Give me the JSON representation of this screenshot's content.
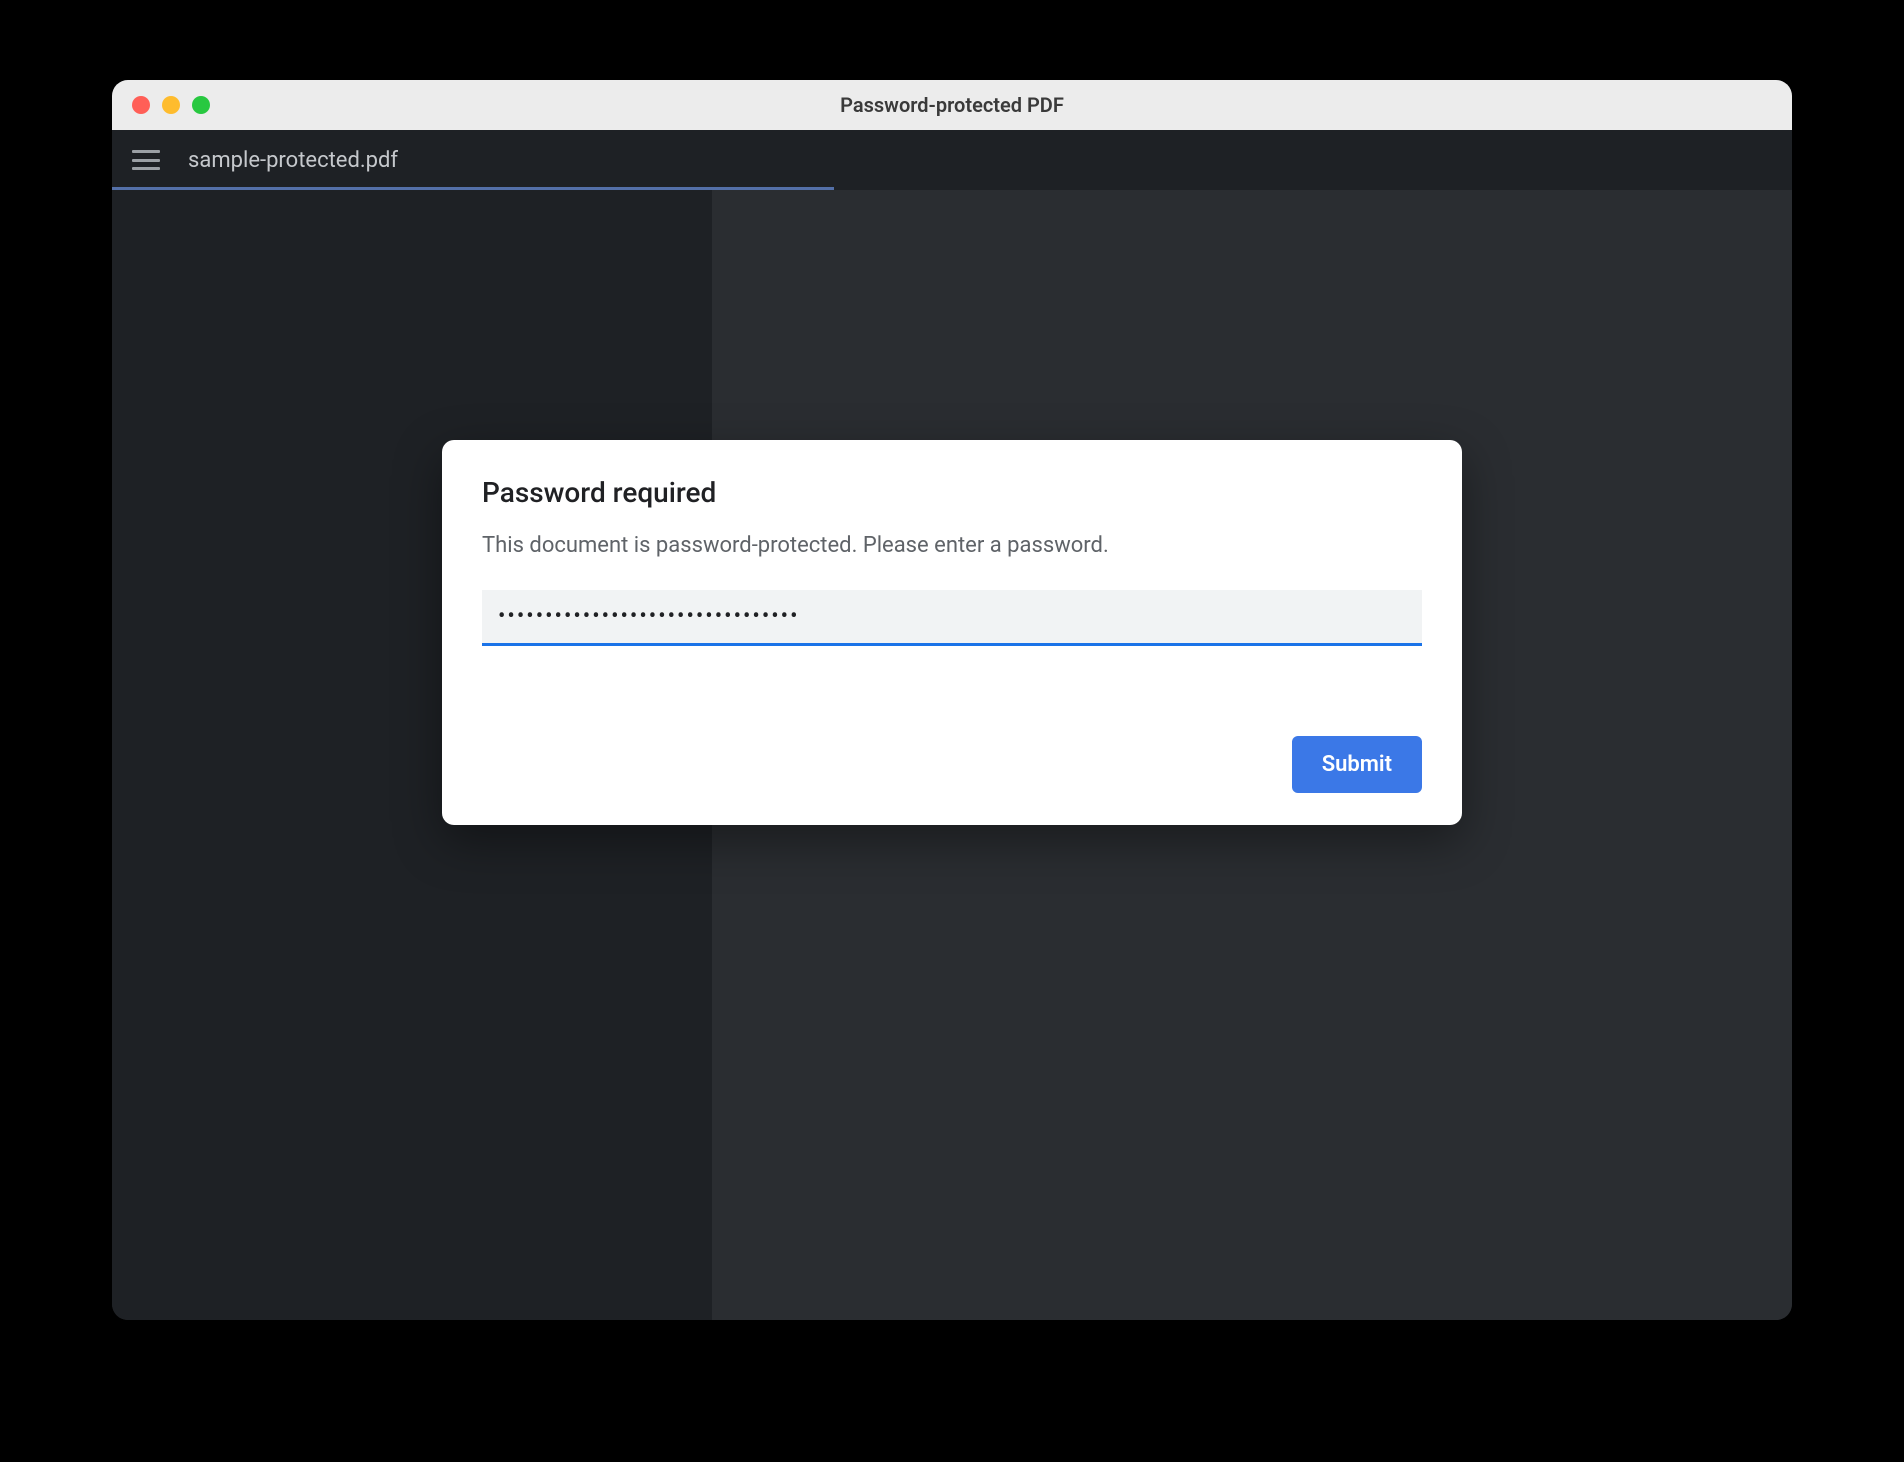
{
  "window": {
    "title": "Password-protected PDF"
  },
  "toolbar": {
    "filename": "sample-protected.pdf"
  },
  "dialog": {
    "title": "Password required",
    "message": "This document is password-protected. Please enter a password.",
    "password_value": "••••••••••••••••••••••••••••••••",
    "submit_label": "Submit"
  },
  "colors": {
    "accent": "#1a73e8",
    "button": "#3b78e7"
  }
}
